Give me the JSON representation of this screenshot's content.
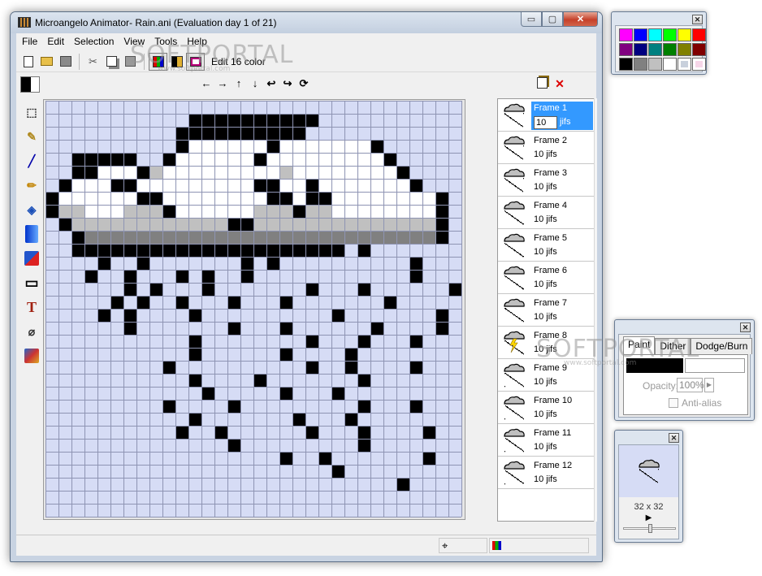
{
  "window": {
    "title": "Microangelo Animator- Rain.ani  (Evaluation day 1 of 21)",
    "min_glyph": "▭",
    "max_glyph": "▢",
    "close_glyph": "✕"
  },
  "menu": [
    "File",
    "Edit",
    "Selection",
    "View",
    "Tools",
    "Help"
  ],
  "toolbar": {
    "mode_label": "Edit 16 color",
    "icons": [
      "new-icon",
      "open-icon",
      "save-icon",
      "cut-icon",
      "copy-icon",
      "paste-icon",
      "color-mode-icon",
      "bw-mode-icon",
      "view-mode-icon"
    ]
  },
  "shift_arrows": [
    "←",
    "→",
    "↑",
    "↓",
    "↩",
    "↪",
    "⟳"
  ],
  "tools": [
    "select",
    "lasso",
    "line",
    "pencil",
    "fill",
    "gradient",
    "replace",
    "rectangle",
    "text",
    "eyedropper",
    "effects"
  ],
  "tool_glyphs": [
    "⬚",
    "✎",
    "╱",
    "✏",
    "◈",
    "▮",
    "✂",
    "▭",
    "T",
    "⌀",
    "▦"
  ],
  "colors": {
    "canvas_bg": "#d6dcf5",
    "grid_line": "#8e94b3",
    "palette": [
      "#ff00ff",
      "#0000ff",
      "#00ffff",
      "#00ff00",
      "#ffff00",
      "#ff0000",
      "#800080",
      "#000080",
      "#008080",
      "#008000",
      "#808000",
      "#800000",
      "#000000",
      "#808080",
      "#c0c0c0",
      "#ffffff"
    ],
    "selected": "#3399ff"
  },
  "frames": [
    {
      "name": "Frame 1",
      "time": "10",
      "unit": "jifs",
      "selected": true
    },
    {
      "name": "Frame 2",
      "time": "10 jifs"
    },
    {
      "name": "Frame 3",
      "time": "10 jifs"
    },
    {
      "name": "Frame 4",
      "time": "10 jifs"
    },
    {
      "name": "Frame 5",
      "time": "10 jifs"
    },
    {
      "name": "Frame 6",
      "time": "10 jifs"
    },
    {
      "name": "Frame 7",
      "time": "10 jifs"
    },
    {
      "name": "Frame 8",
      "time": "10 jifs",
      "lightning": true
    },
    {
      "name": "Frame 9",
      "time": "10 jifs"
    },
    {
      "name": "Frame 10",
      "time": "10 jifs"
    },
    {
      "name": "Frame 11",
      "time": "10 jifs"
    },
    {
      "name": "Frame 12",
      "time": "10 jifs"
    }
  ],
  "paint_panel": {
    "tabs": [
      "Paint",
      "Dither",
      "Dodge/Burn"
    ],
    "opacity_label": "Opacity:",
    "opacity_value": "100%",
    "antialias_label": "Anti-alias"
  },
  "preview": {
    "size": "32 x 32",
    "play_glyph": "▶"
  },
  "watermark": {
    "text": "SOFTPORTAL",
    "url": "www.softportal.com"
  },
  "pixel_art": [
    "................................",
    "...........##########...........",
    "..........##########............",
    "..........#WWWWWW#WWWWWWW#.......",
    "..#####..#WWWWWW#WWWWWWWWW#......",
    "..##WWW#GWWWWWWWWWGWWWWWWWW#.....",
    ".#WWW##WWWWWWWWW##WW#WWWWWWW#....",
    "#WWWWWW##WWWWWWWW##W##WWWWWWWW#..",
    "#GGWWWGGG#WWWWWWGGG#GGWWWWWWWW#..",
    ".#GGGGGGGGGGGG##GGGGGGGGGGGGGG#..",
    "..#DDDDDDDDDDDDDDDDDDDDDDDDDDD#..",
    "..#####################.#.......",
    "....#..#.......#.#..........#...",
    "...#..#...#.#..#............#...",
    "......#.#...#.......#...#......#",
    ".....#.#..#...#...#.......#.....",
    "....#.#....#..........#.......#.",
    "......#.......#...#......#....#.",
    "...........#........#...#...#...",
    "...........#......#....#........",
    ".........#..........#..#....#...",
    "...........#....#.......#.......",
    "............#.....#...#.........",
    ".........#....#.........#...#...",
    "...........#.......#...#........",
    "..........#..#......#...#....#..",
    "..............#.........#.......",
    "..................#..#.......#..",
    "......................#.........",
    "...........................#....",
    "................................",
    "................................"
  ]
}
